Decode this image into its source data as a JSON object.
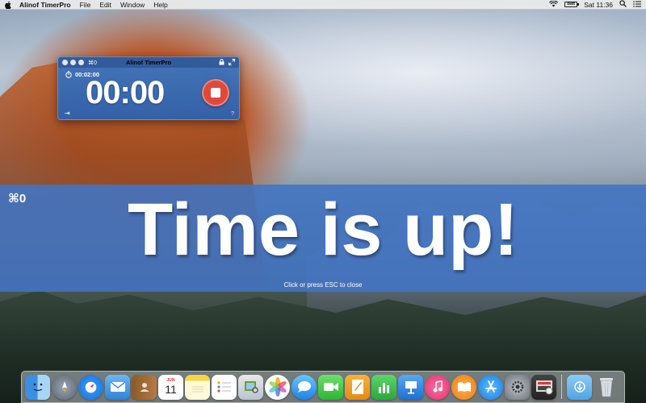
{
  "menubar": {
    "app_name": "Alinof TimerPro",
    "menus": [
      "File",
      "Edit",
      "Window",
      "Help"
    ],
    "clock": "Sat 11:36",
    "battery_label": "Batt"
  },
  "timer": {
    "title": "Alinof TimerPro",
    "shortcut": "⌘0",
    "duration": "00:02:00",
    "display": "00:00",
    "help_icon": "?",
    "collapse_icon": "⇥"
  },
  "banner": {
    "shortcut": "⌘0",
    "message": "Time is up!",
    "hint": "Click or press ESC to close"
  },
  "dock": {
    "calendar_month": "JUN",
    "calendar_day": "11",
    "items": [
      "finder",
      "launchpad",
      "safari",
      "mail",
      "contacts",
      "calendar",
      "notes",
      "reminders",
      "preview",
      "photos",
      "messages",
      "facetime",
      "pages",
      "numbers",
      "keynote",
      "itunes",
      "ibooks",
      "app-store",
      "system-preferences",
      "timerpro",
      "downloads",
      "trash"
    ]
  },
  "colors": {
    "banner": "#4274c4",
    "timer_bg": "#3a76c4",
    "stop": "#e0483c"
  }
}
